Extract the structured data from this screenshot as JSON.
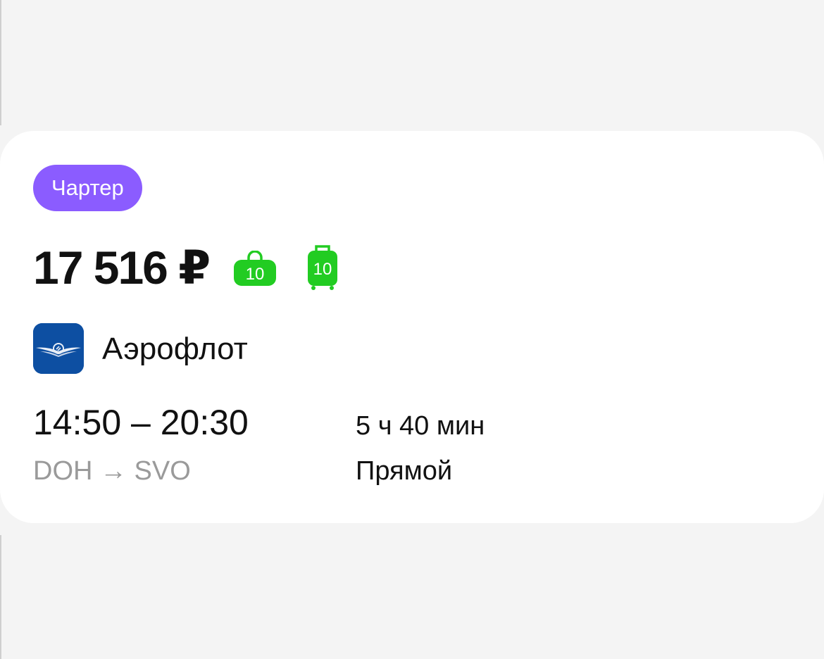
{
  "card": {
    "badge": "Чартер",
    "price": "17 516 ₽",
    "baggage": {
      "hand_icon": "hand-luggage-icon",
      "hand_kg": "10",
      "checked_icon": "suitcase-icon",
      "checked_kg": "10",
      "color": "#22cc22"
    },
    "airline": {
      "logo_icon": "aeroflot-logo-icon",
      "name": "Аэрофлот",
      "logo_color": "#0d4fa2"
    },
    "times": "14:50 – 20:30",
    "route": "DOH → SVO",
    "duration": "5 ч 40 мин",
    "stops": "Прямой"
  },
  "colors": {
    "badge": "#8b5cff",
    "background": "#f4f4f4",
    "card": "#ffffff",
    "muted_text": "#9a9a9a"
  }
}
